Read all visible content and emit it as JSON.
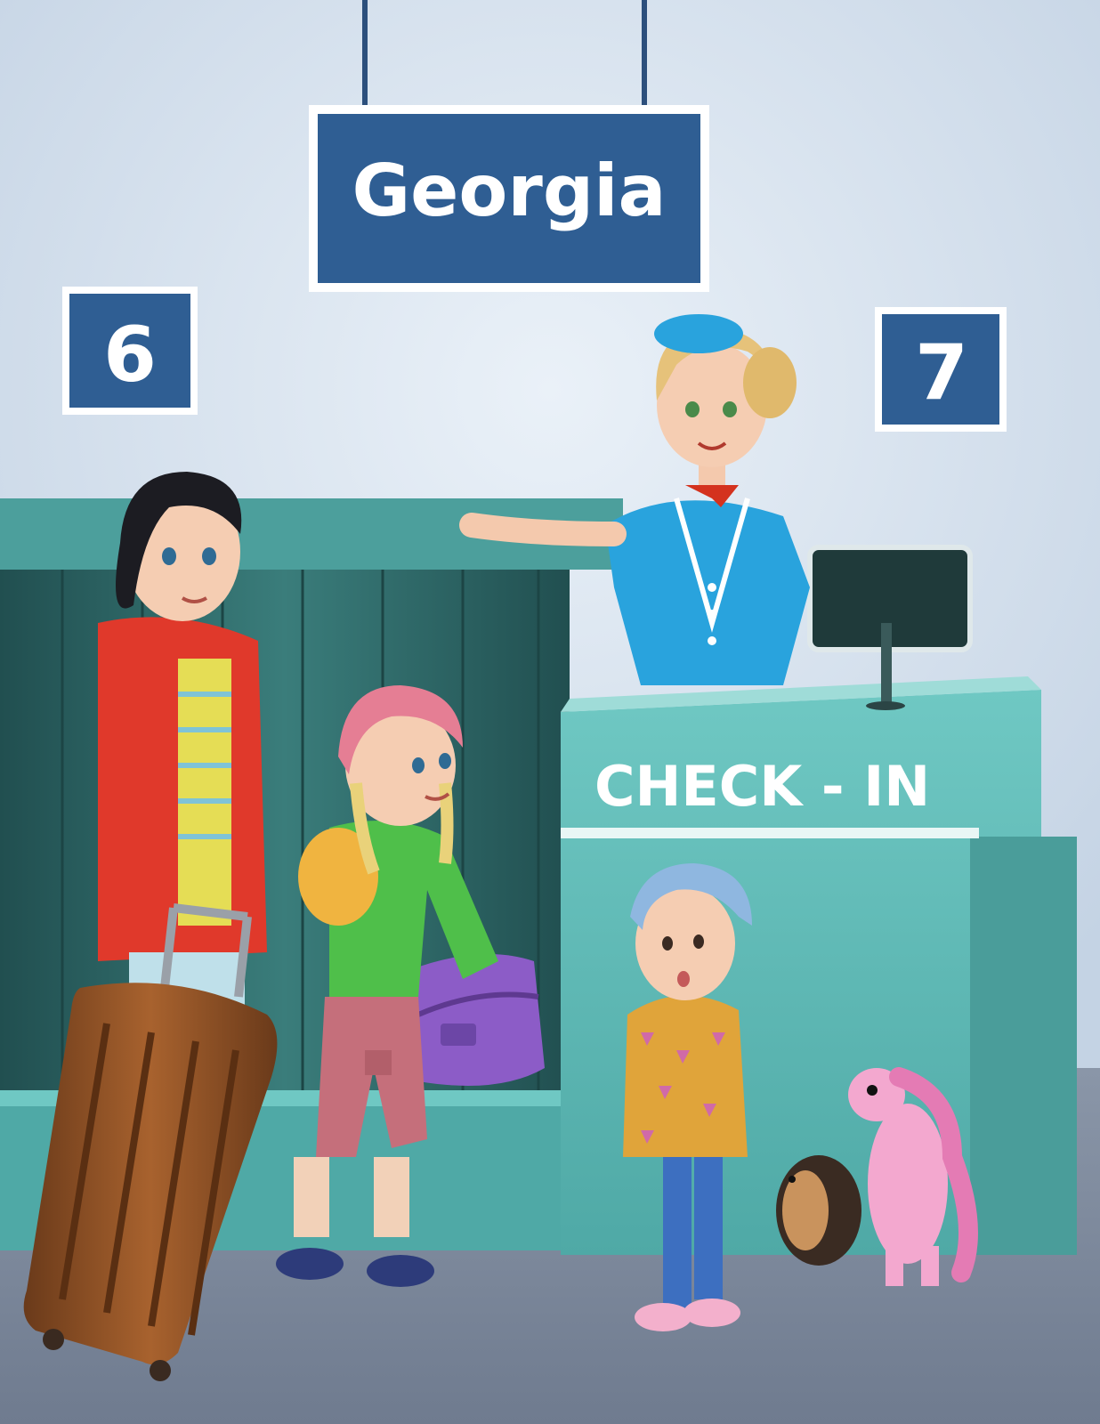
{
  "signs": {
    "destination": "Georgia",
    "gate_left": "6",
    "gate_right": "7"
  },
  "desk": {
    "label": "CHECK - IN"
  },
  "colors": {
    "sky_wall": "#d6e2ef",
    "sign_blue": "#2f5e93",
    "desk_teal": "#5cbcb8",
    "belt_teal": "#2f6f6e",
    "floor_gray": "#7d8a9e",
    "uniform_blue": "#29a3dd"
  }
}
